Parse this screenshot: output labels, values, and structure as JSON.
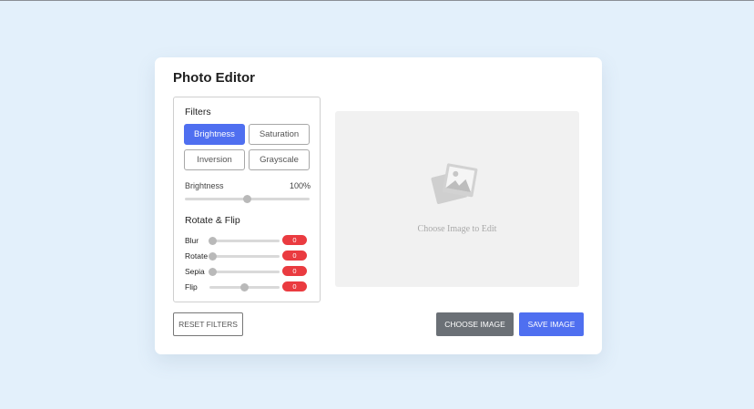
{
  "app": {
    "title": "Photo Editor"
  },
  "filters": {
    "heading": "Filters",
    "options": [
      {
        "label": "Brightness",
        "active": true
      },
      {
        "label": "Saturation",
        "active": false
      },
      {
        "label": "Inversion",
        "active": false
      },
      {
        "label": "Grayscale",
        "active": false
      }
    ],
    "slider": {
      "label": "Brightness",
      "value_text": "100%",
      "fraction": 0.5
    }
  },
  "rotate_flip": {
    "heading": "Rotate & Flip",
    "controls": [
      {
        "label": "Blur",
        "value": "0",
        "fraction": 0.0
      },
      {
        "label": "Rotate",
        "value": "0",
        "fraction": 0.0
      },
      {
        "label": "Sepia",
        "value": "0",
        "fraction": 0.0
      },
      {
        "label": "Flip",
        "value": "0",
        "fraction": 0.5
      }
    ]
  },
  "preview": {
    "placeholder": "Choose Image to Edit",
    "icon": "photo-placeholder-icon"
  },
  "actions": {
    "reset": "RESET FILTERS",
    "choose": "CHOOSE IMAGE",
    "save": "SAVE IMAGE"
  },
  "colors": {
    "accent": "#4f6ff0",
    "badge": "#ea3b40",
    "choose": "#6b7076",
    "background": "#e3f0fb"
  }
}
